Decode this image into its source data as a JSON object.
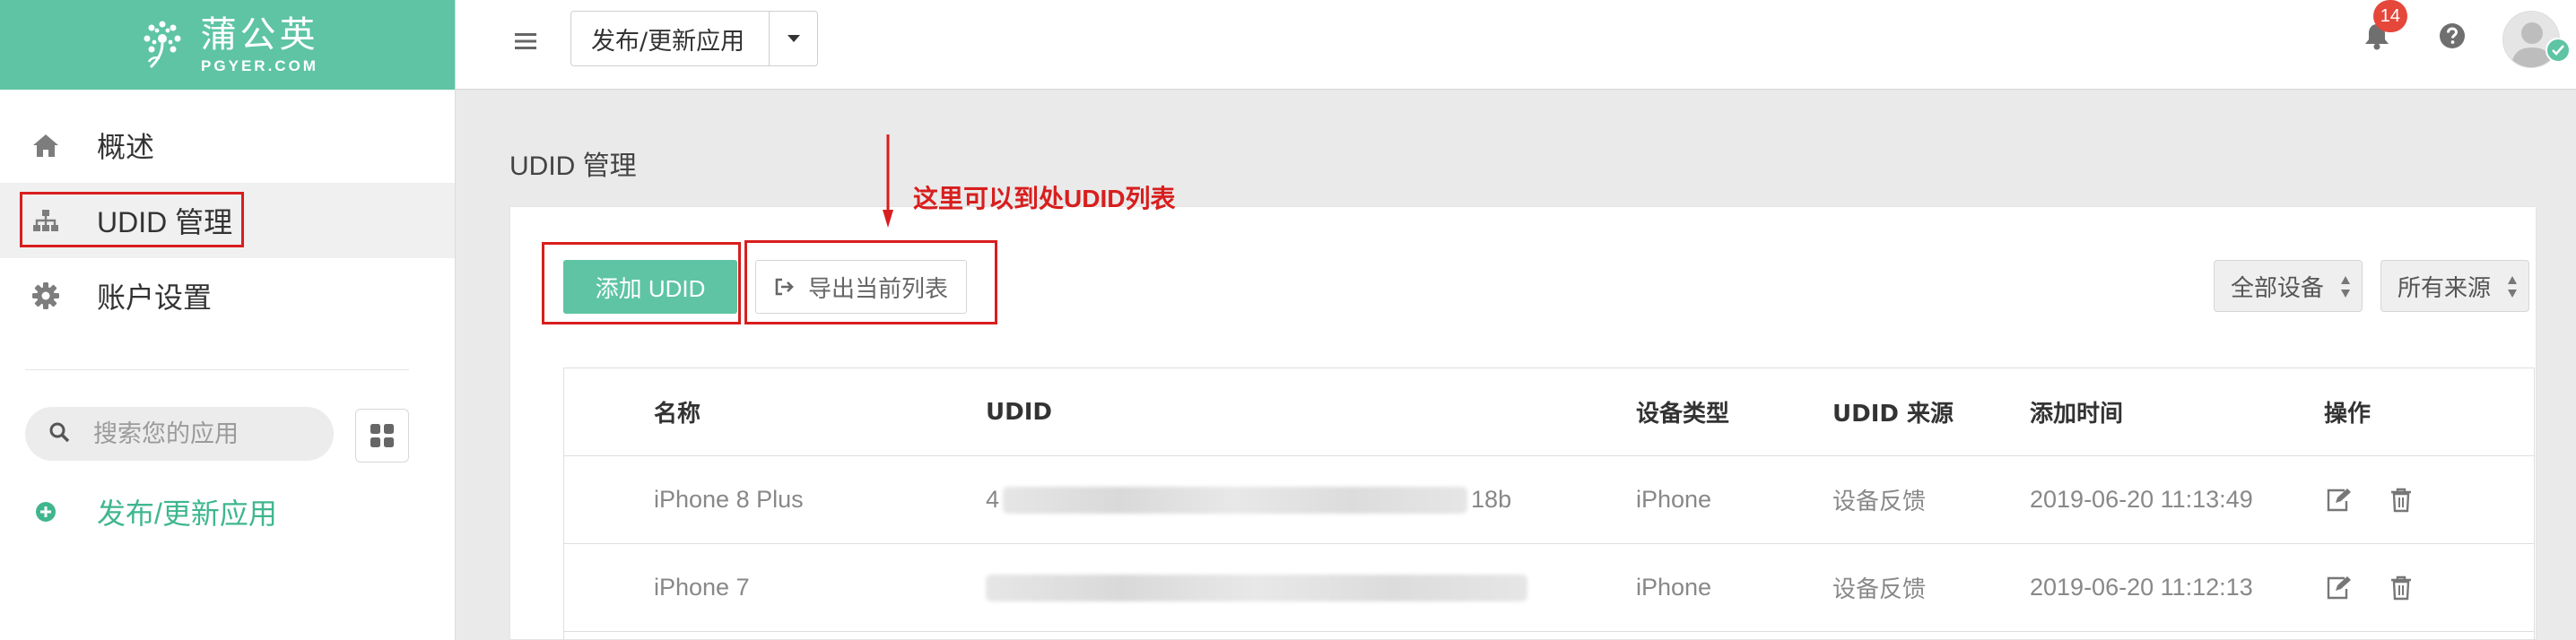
{
  "brand": {
    "name_cn": "蒲公英",
    "name_en": "PGYER.COM",
    "color": "#5ec4a4"
  },
  "sidebar": {
    "items": [
      {
        "label": "概述",
        "icon": "home-icon"
      },
      {
        "label": "UDID 管理",
        "icon": "sitemap-icon",
        "active": true
      },
      {
        "label": "账户设置",
        "icon": "gear-icon"
      }
    ],
    "search": {
      "placeholder": "搜索您的应用",
      "icon": "search-icon"
    },
    "grid_icon": "grid-icon",
    "publish": {
      "label": "发布/更新应用",
      "icon": "plus-circle-icon"
    }
  },
  "topbar": {
    "app_select": {
      "value": "发布/更新应用"
    },
    "notifications": {
      "count": "14"
    },
    "icons": [
      "menu-icon",
      "bell-icon",
      "help-icon",
      "avatar"
    ]
  },
  "main": {
    "title": "UDID 管理",
    "add_button": "添加 UDID",
    "export_button": "导出当前列表",
    "annotation": "这里可以到处UDID列表",
    "filters": {
      "device": "全部设备",
      "source": "所有来源"
    }
  },
  "table": {
    "headers": {
      "name": "名称",
      "udid": "UDID",
      "type": "设备类型",
      "source": "UDID 来源",
      "time": "添加时间",
      "actions": "操作"
    },
    "rows": [
      {
        "name": "iPhone 8 Plus",
        "udid_start": "4",
        "udid_end": "18b",
        "type": "iPhone",
        "source": "设备反馈",
        "time": "2019-06-20 11:13:49"
      },
      {
        "name": "iPhone 7",
        "udid_start": "",
        "udid_end": "",
        "type": "iPhone",
        "source": "设备反馈",
        "time": "2019-06-20 11:12:13"
      }
    ]
  },
  "colors": {
    "accent": "#5ec4a4",
    "annotation": "#d81e1e",
    "badge": "#e5473b"
  }
}
